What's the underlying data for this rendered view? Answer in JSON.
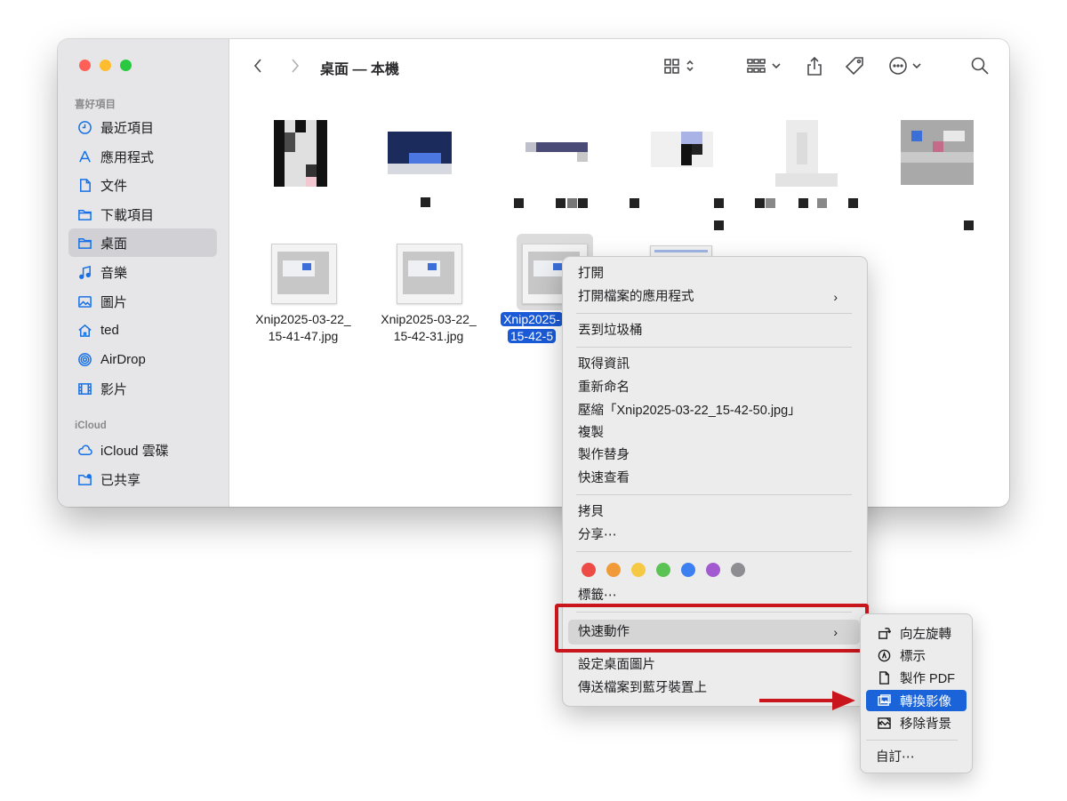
{
  "window": {
    "title": "桌面 — 本機"
  },
  "sidebar": {
    "favorites_label": "喜好項目",
    "cloud_label": "iCloud",
    "favorites": [
      {
        "label": "最近項目",
        "icon": "clock-icon"
      },
      {
        "label": "應用程式",
        "icon": "applications-icon"
      },
      {
        "label": "文件",
        "icon": "document-icon"
      },
      {
        "label": "下載項目",
        "icon": "folder-icon"
      },
      {
        "label": "桌面",
        "icon": "folder-icon",
        "selected": true
      },
      {
        "label": "音樂",
        "icon": "music-note-icon"
      },
      {
        "label": "圖片",
        "icon": "photo-icon"
      },
      {
        "label": "ted",
        "icon": "home-icon"
      },
      {
        "label": "AirDrop",
        "icon": "airdrop-icon"
      },
      {
        "label": "影片",
        "icon": "film-icon"
      }
    ],
    "cloud_items": [
      {
        "label": "iCloud 雲碟",
        "icon": "cloud-icon"
      },
      {
        "label": "已共享",
        "icon": "shared-folder-icon"
      }
    ]
  },
  "files": [
    {
      "name_line1": "Xnip2025-03-22_",
      "name_line2": "15-41-47.jpg"
    },
    {
      "name_line1": "Xnip2025-03-22_",
      "name_line2": "15-42-31.jpg"
    },
    {
      "name_line1": "Xnip2025-",
      "name_line2": "15-42-5",
      "selected": true
    }
  ],
  "context_menu": {
    "open": "打開",
    "open_with": "打開檔案的應用程式",
    "move_to_trash": "丟到垃圾桶",
    "get_info": "取得資訊",
    "rename": "重新命名",
    "compress": "壓縮「Xnip2025-03-22_15-42-50.jpg」",
    "duplicate": "複製",
    "make_alias": "製作替身",
    "quick_look": "快速查看",
    "copy": "拷貝",
    "share": "分享⋯",
    "tag_colors": [
      "#ec4c45",
      "#f19a38",
      "#f5c944",
      "#5bc254",
      "#3b7ff0",
      "#a35ad1",
      "#8e8e92"
    ],
    "tags": "標籤⋯",
    "quick_actions": "快速動作",
    "set_desktop_picture": "設定桌面圖片",
    "send_bluetooth": "傳送檔案到藍牙裝置上"
  },
  "submenu": {
    "items": [
      {
        "label": "向左旋轉",
        "icon": "rotate-left-icon"
      },
      {
        "label": "標示",
        "icon": "markup-icon"
      },
      {
        "label": "製作 PDF",
        "icon": "pdf-document-icon"
      },
      {
        "label": "轉換影像",
        "icon": "convert-image-icon",
        "active": true
      },
      {
        "label": "移除背景",
        "icon": "remove-background-icon"
      }
    ],
    "customize": "自訂⋯"
  },
  "colors": {
    "accent": "#1a63d8",
    "highlight_box": "#c9161d"
  }
}
